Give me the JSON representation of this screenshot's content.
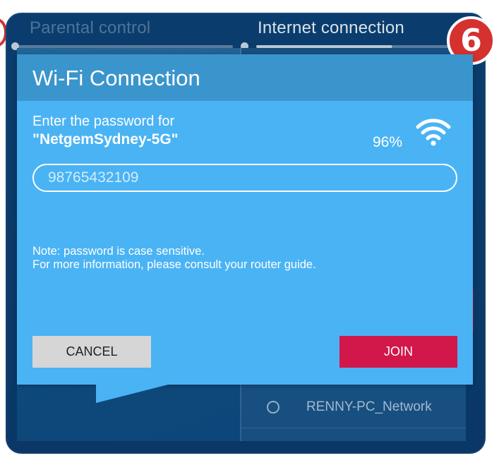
{
  "steps": {
    "previous_label": "Parental control",
    "current_label": "Internet connection"
  },
  "badge": {
    "number": "6"
  },
  "dialog": {
    "title": "Wi-Fi Connection",
    "prompt": "Enter the password for",
    "ssid": "\"NetgemSydney-5G\"",
    "signal_strength": "96%",
    "password_value": "98765432109",
    "note_line1": "Note: password is case sensitive.",
    "note_line2": "For more information, please consult your router guide.",
    "cancel_label": "CANCEL",
    "join_label": "JOIN"
  },
  "background": {
    "network_item": "RENNY-PC_Network"
  },
  "colors": {
    "dialog_bg": "#4ab3f4",
    "dialog_header": "#3a95cc",
    "join_button": "#d2174a",
    "cancel_button": "#d6d6d6",
    "badge": "#d4312f"
  },
  "icons": {
    "signal": "wifi-icon",
    "network_radio": "radio-button"
  }
}
